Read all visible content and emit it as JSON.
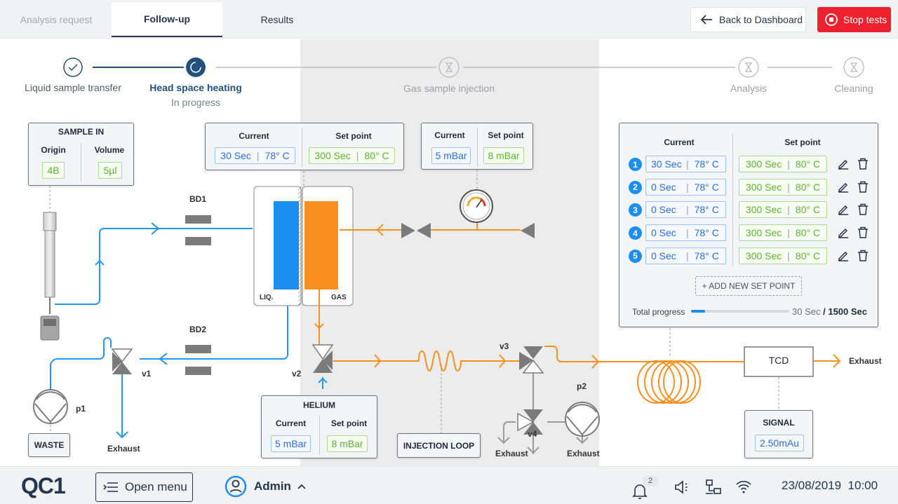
{
  "tabs": [
    {
      "label": "Analysis request",
      "state": "inactive"
    },
    {
      "label": "Follow-up",
      "state": "active"
    },
    {
      "label": "Results",
      "state": "normal"
    }
  ],
  "header": {
    "back_label": "Back to Dashboard",
    "stop_label": "Stop tests"
  },
  "steps": [
    {
      "label": "Liquid sample transfer",
      "status": "done"
    },
    {
      "label": "Head space heating",
      "status": "active",
      "sub": "In progress"
    },
    {
      "label": "Gas sample injection",
      "status": "pending"
    },
    {
      "label": "Analysis",
      "status": "pending"
    },
    {
      "label": "Cleaning",
      "status": "pending"
    }
  ],
  "sample_in": {
    "title": "SAMPLE IN",
    "origin_label": "Origin",
    "volume_label": "Volume",
    "origin": "4B",
    "volume": "5µl"
  },
  "heating": {
    "current_label": "Current",
    "setpoint_label": "Set point",
    "current_time": "30 Sec",
    "current_temp": "78° C",
    "set_time": "300 Sec",
    "set_temp": "80° C"
  },
  "pressure": {
    "current_label": "Current",
    "setpoint_label": "Set point",
    "current": "5 mBar",
    "setpoint": "8 mBar"
  },
  "helium": {
    "title": "HELIUM",
    "current_label": "Current",
    "setpoint_label": "Set point",
    "current": "5 mBar",
    "setpoint": "8 mBar"
  },
  "signal": {
    "title": "SIGNAL",
    "value": "2.50mAu"
  },
  "labels": {
    "bd1": "BD1",
    "bd2": "BD2",
    "liq": "LIQ.",
    "gas": "GAS",
    "v1": "v1",
    "v2": "v2",
    "v3": "v3",
    "v4": "v4",
    "p1": "p1",
    "p2": "p2",
    "waste": "WASTE",
    "injection_loop": "INJECTION LOOP",
    "tcd": "TCD",
    "exhaust": "Exhaust"
  },
  "setpoints": {
    "current_label": "Current",
    "setpoint_label": "Set point",
    "rows": [
      {
        "n": "1",
        "cur_time": "30 Sec",
        "cur_temp": "78° C",
        "set_time": "300 Sec",
        "set_temp": "80° C"
      },
      {
        "n": "2",
        "cur_time": "0 Sec",
        "cur_temp": "78° C",
        "set_time": "300 Sec",
        "set_temp": "80° C"
      },
      {
        "n": "3",
        "cur_time": "0 Sec",
        "cur_temp": "78° C",
        "set_time": "300 Sec",
        "set_temp": "80° C"
      },
      {
        "n": "4",
        "cur_time": "0 Sec",
        "cur_temp": "78° C",
        "set_time": "300 Sec",
        "set_temp": "80° C"
      },
      {
        "n": "5",
        "cur_time": "0 Sec",
        "cur_temp": "78° C",
        "set_time": "300 Sec",
        "set_temp": "80° C"
      }
    ],
    "add_label": "+ ADD NEW SET POINT",
    "progress_label": "Total progress",
    "progress_fraction": 0.02,
    "progress_current": "30 Sec",
    "progress_total": "/ 1500 Sec"
  },
  "footer": {
    "logo": "QC1",
    "menu_label": "Open menu",
    "user": "Admin",
    "notifications": "2",
    "datetime": "23/08/2019  10:00"
  },
  "colors": {
    "liquid": "#2196f3",
    "gas": "#f7901e",
    "pipe_gray": "#9a9a9a",
    "stop": "#f0212e",
    "nav": "#23354f"
  }
}
